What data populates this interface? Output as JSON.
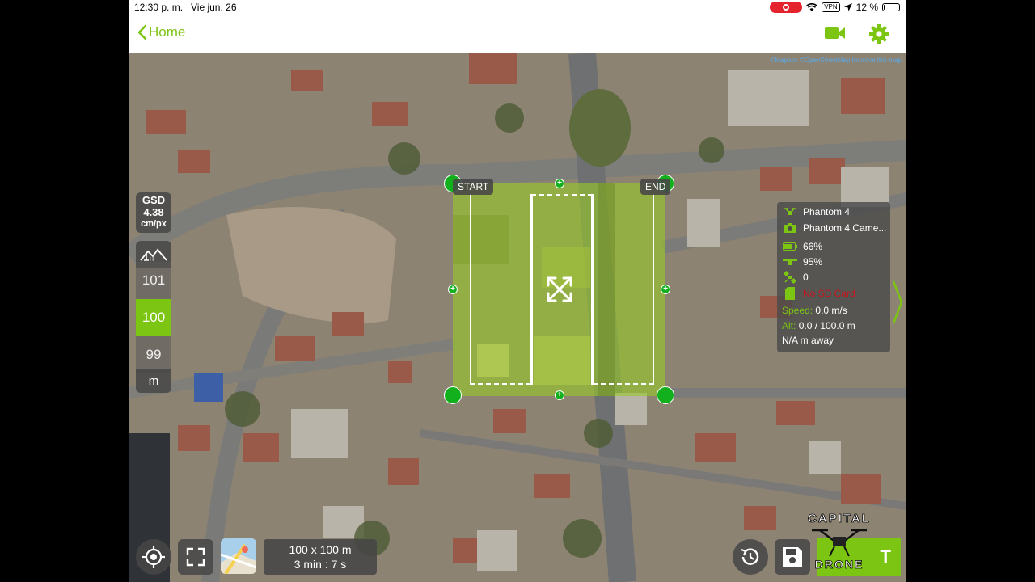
{
  "status_bar": {
    "time": "12:30 p. m.",
    "date": "Vie jun. 26",
    "vpn": "VPN",
    "battery": "12 %",
    "battery_level": 0.12
  },
  "nav": {
    "back_label": "Home"
  },
  "map": {
    "attribution": "©Mapbox  ©OpenStreetMap  Improve this map"
  },
  "gsd": {
    "label": "GSD",
    "value": "4.38",
    "unit": "cm/px"
  },
  "altitude": {
    "above": "101",
    "selected": "100",
    "below": "99",
    "unit": "m"
  },
  "area": {
    "start_label": "START",
    "end_label": "END"
  },
  "telemetry": {
    "aircraft": "Phantom 4",
    "camera": "Phantom 4 Came...",
    "battery": "66%",
    "signal": "95%",
    "satellites": "0",
    "sd_card": "No SD Card",
    "speed_label": "Speed:",
    "speed_value": "0.0 m/s",
    "alt_label": "Alt:",
    "alt_value": "0.0 / 100.0 m",
    "distance": "N/A m away"
  },
  "mission": {
    "size": "100 x 100 m",
    "duration": "3 min : 7 s"
  },
  "start": {
    "label": "T"
  },
  "watermark": {
    "text_top": "CAPITAL",
    "text_bottom": "DRONE"
  },
  "colors": {
    "accent": "#7cc513",
    "handle": "#13b01e",
    "alert": "#c4161c"
  }
}
